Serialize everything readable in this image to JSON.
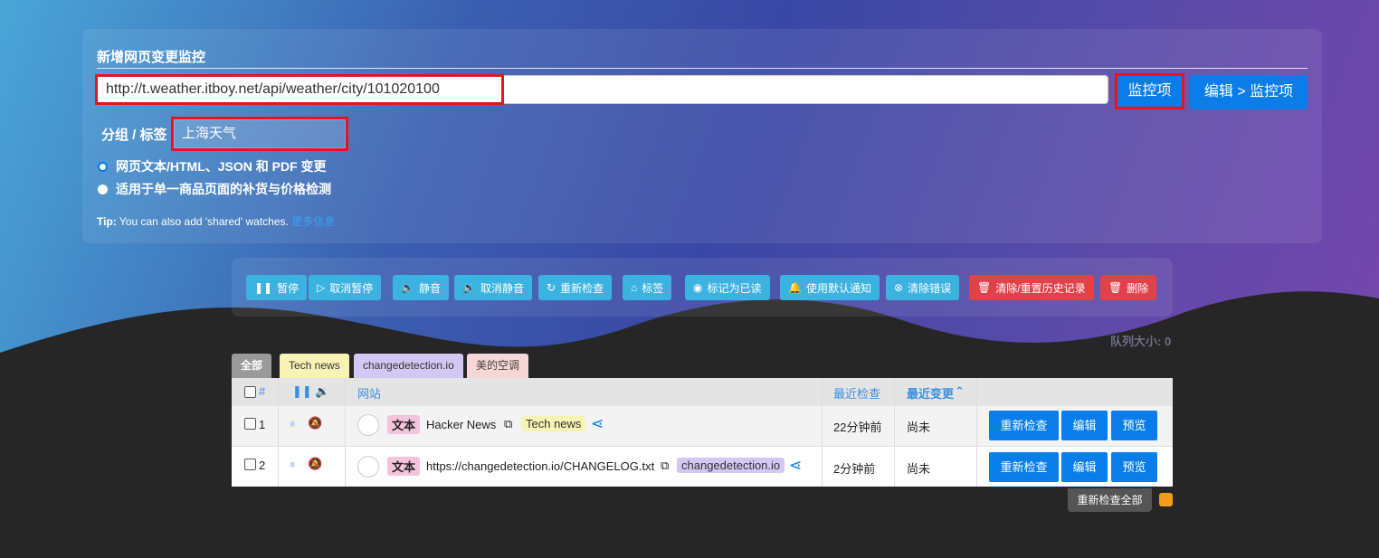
{
  "add_watch": {
    "title": "新增网页变更监控",
    "url_value": "http://t.weather.itboy.net/api/weather/city/101020100",
    "watch_button": "监控项",
    "edit_watch_button": "编辑 > 监控项",
    "group_label": "分组 / 标签",
    "tag_value": "上海天气",
    "option_1": "网页文本/HTML、JSON 和 PDF 变更",
    "option_2": "适用于单一商品页面的补货与价格检测",
    "tip_prefix": "Tip:",
    "tip_text": "You can also add 'shared' watches.",
    "tip_link": "更多信息"
  },
  "actions": [
    {
      "label": "暂停",
      "icon": "pause-icon"
    },
    {
      "label": "取消暂停",
      "icon": "play-icon"
    },
    {
      "label": "静音",
      "icon": "mute-icon"
    },
    {
      "label": "取消静音",
      "icon": "volume-icon"
    },
    {
      "label": "重新检查",
      "icon": "refresh-icon"
    },
    {
      "label": "标签",
      "icon": "tag-icon"
    },
    {
      "label": "标记为已读",
      "icon": "eye-icon"
    },
    {
      "label": "使用默认通知",
      "icon": "bell-icon"
    },
    {
      "label": "清除错误",
      "icon": "x-circle-icon"
    },
    {
      "label": "清除/重置历史记录",
      "icon": "trash-icon"
    },
    {
      "label": "删除",
      "icon": "trash-icon"
    }
  ],
  "queue_size": "队列大小: 0",
  "tabs": [
    "全部",
    "Tech news",
    "changedetection.io",
    "美的空调"
  ],
  "table": {
    "headers": {
      "num": "#",
      "site": "网站",
      "last_checked": "最近检查",
      "last_changed": "最近变更"
    },
    "rows": [
      {
        "num": "1",
        "badge": "文本",
        "title": "Hacker News",
        "tag": "Tech news",
        "last_checked": "22分钟前",
        "last_changed": "尚未"
      },
      {
        "num": "2",
        "badge": "文本",
        "title": "https://changedetection.io/CHANGELOG.txt",
        "tag": "changedetection.io",
        "last_checked": "2分钟前",
        "last_changed": "尚未"
      }
    ],
    "row_buttons": {
      "recheck": "重新检查",
      "edit": "编辑",
      "preview": "预览"
    }
  },
  "recheck_all": "重新检查全部",
  "colors": {
    "primary": "#0a7de8",
    "action": "#3bb3e0",
    "danger": "#e2414a",
    "highlight": "#e8141c"
  }
}
